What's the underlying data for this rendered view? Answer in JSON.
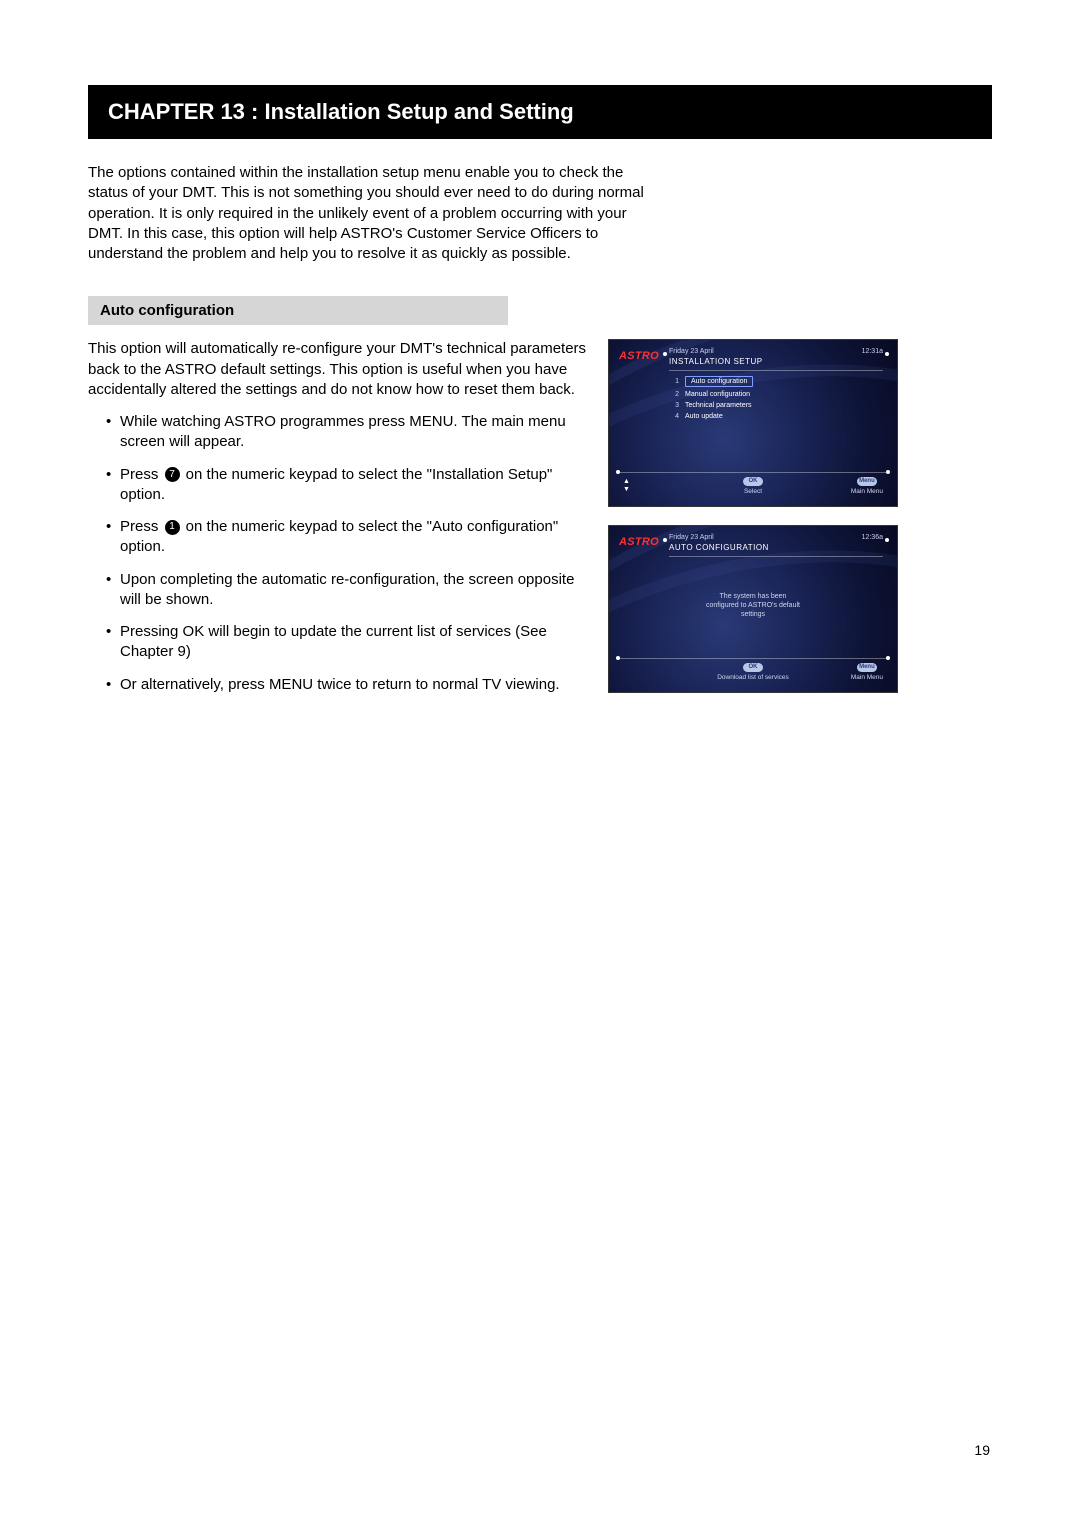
{
  "chapter_title": "CHAPTER 13 : Installation Setup and Setting",
  "intro_text": "The options contained within the installation setup menu enable you to check the status of your DMT. This is not something you should ever need to do during normal operation.  It is only required in the unlikely event of a problem occurring with your DMT.  In this case, this option will help ASTRO's Customer Service Officers to understand the problem and help you to resolve it as quickly as possible.",
  "section_title": "Auto configuration",
  "section_desc": "This option will automatically re-configure your DMT's technical parameters back to the ASTRO default settings. This option is useful when you have accidentally altered the settings and do not know how to reset them back.",
  "steps": {
    "s1": "While watching ASTRO programmes press MENU. The main menu screen will appear.",
    "s2a": "Press ",
    "s2n": "7",
    "s2b": " on the numeric keypad to select the \"Installation Setup\" option.",
    "s3a": "Press ",
    "s3n": "1",
    "s3b": "  on the numeric keypad to select the \"Auto configuration\" option.",
    "s4": "Upon completing the automatic re-configuration, the screen opposite will be shown.",
    "s5": "Pressing OK will begin to update the current list of services (See Chapter 9)",
    "s6": "Or alternatively, press MENU twice to return to normal TV viewing."
  },
  "tv": {
    "logo": "ASTRO",
    "date": "Friday 23 April",
    "ok": "OK",
    "menu": "Menu",
    "main_menu": "Main Menu"
  },
  "screen1": {
    "title": "INSTALLATION SETUP",
    "time": "12:31a",
    "items": {
      "i1": "Auto configuration",
      "i2": "Manual configuration",
      "i3": "Technical parameters",
      "i4": "Auto update"
    },
    "footer_center": "Select"
  },
  "screen2": {
    "title": "AUTO CONFIGURATION",
    "time": "12:36a",
    "msg1": "The system has been",
    "msg2": "configured to ASTRO's default",
    "msg3": "settings",
    "footer_center": "Download list of services"
  },
  "page_number": "19"
}
